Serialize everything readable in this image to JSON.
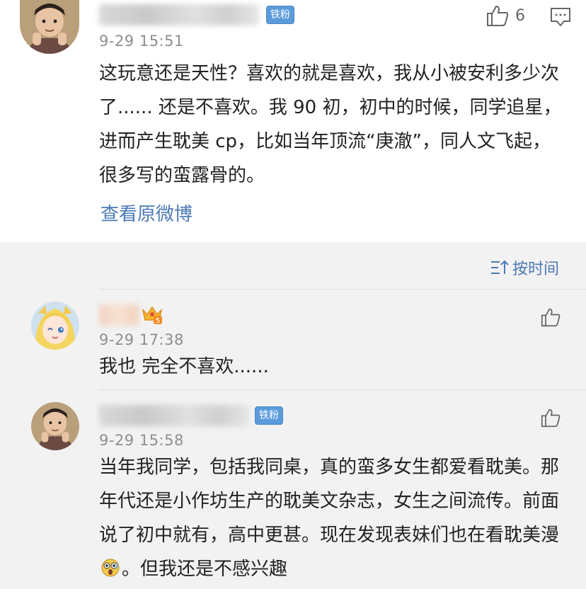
{
  "post": {
    "badge": "铁粉",
    "time": "9-29 15:51",
    "like_count": "6",
    "text": "这玩意还是天性？喜欢的就是喜欢，我从小被安利多少次了...... 还是不喜欢。我 90 初，初中的时候，同学追星，进而产生耽美 cp，比如当年顶流“庚澈”，同人文飞起，很多写的蛮露骨的。",
    "view_original": "查看原微博"
  },
  "sort": {
    "label": "按时间"
  },
  "comments": [
    {
      "time": "9-29 17:38",
      "text": "我也 完全不喜欢......",
      "level": "5"
    },
    {
      "badge": "铁粉",
      "time": "9-29 15:58",
      "text_before": "当年我同学，包括我同桌，真的蛮多女生都爱看耽美。那年代还是小作坊生产的耽美文杂志，女生之间流传。前面说了初中就有，高中更甚。现在发现表妹们也在看耽美漫",
      "text_after": "。但我还是不感兴趣"
    }
  ],
  "icons": {
    "like": "thumbs-up-icon",
    "comment": "comment-icon",
    "sort": "sort-icon",
    "crown": "crown-level-icon",
    "emoji": "surprised-face-emoji"
  },
  "colors": {
    "link": "#4b7ab5",
    "badge": "#5b9bdc",
    "time": "#8e8e8e",
    "background": "#f2f2f2"
  }
}
